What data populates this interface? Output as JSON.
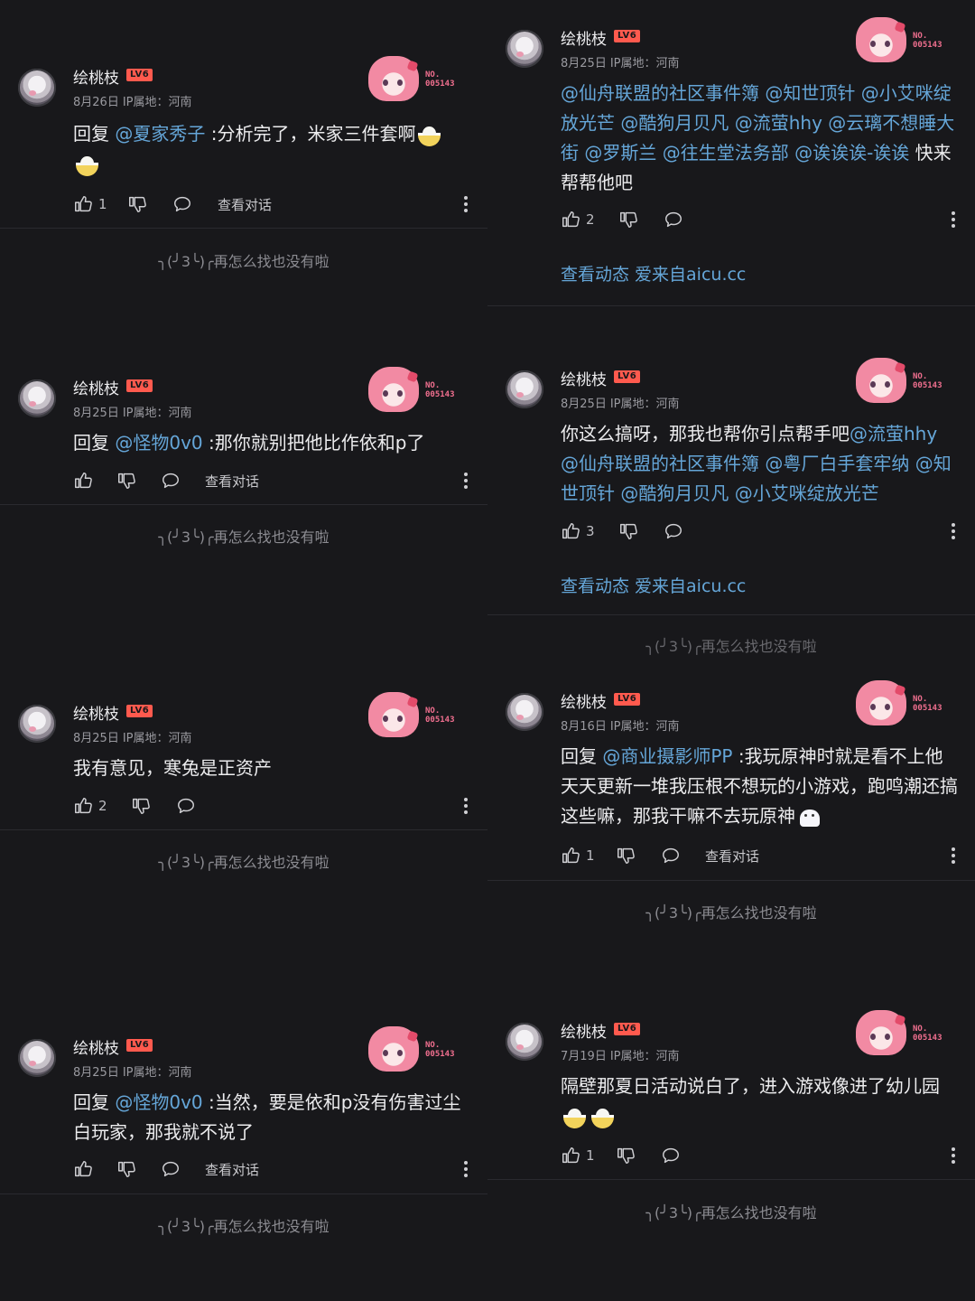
{
  "common": {
    "username": "绘桃枝",
    "level": "LV6",
    "location": "IP属地：河南",
    "badge_no": "NO.",
    "badge_num": "005143",
    "view_dialog": "查看对话",
    "end_note": "╮(╯3╰)╭再怎么找也没有啦",
    "footer_link": "查看动态 爱来自aicu.cc"
  },
  "left": [
    {
      "date": "8月26日",
      "likes": "1",
      "parts": [
        {
          "t": "回复 "
        },
        {
          "t": "@夏家秀子",
          "m": true
        },
        {
          "t": " :分析完了，米家三件套啊"
        },
        {
          "e": "bowl"
        },
        {
          "e": "bowl"
        }
      ]
    },
    {
      "date": "8月25日",
      "likes": "",
      "parts": [
        {
          "t": "回复 "
        },
        {
          "t": "@怪物0v0",
          "m": true
        },
        {
          "t": " :那你就别把他比作依和p了"
        }
      ]
    },
    {
      "date": "8月25日",
      "likes": "2",
      "parts": [
        {
          "t": "我有意见，寒兔是正资产"
        }
      ]
    },
    {
      "date": "8月25日",
      "likes": "",
      "parts": [
        {
          "t": "回复 "
        },
        {
          "t": "@怪物0v0",
          "m": true
        },
        {
          "t": " :当然，要是依和p没有伤害过尘白玩家，那我就不说了"
        }
      ]
    }
  ],
  "right": [
    {
      "date": "8月25日",
      "likes": "2",
      "parts": [
        {
          "t": "@仙舟联盟的社区事件簿 @知世顶针 @小艾咪绽放光芒 @酷狗月贝凡 @流萤hhy @云璃不想睡大街 @罗斯兰 @往生堂法务部 @诶诶诶-诶诶",
          "m": true
        },
        {
          "t": " 快来帮帮他吧"
        }
      ]
    },
    {
      "date": "8月25日",
      "likes": "3",
      "parts": [
        {
          "t": "你这么搞呀，那我也帮你引点帮手吧"
        },
        {
          "t": "@流萤hhy @仙舟联盟的社区事件簿 @粤厂白手套牢纳 @知世顶针 @酷狗月贝凡 @小艾咪绽放光芒",
          "m": true
        }
      ]
    },
    {
      "date": "8月16日",
      "likes": "1",
      "parts": [
        {
          "t": "回复 "
        },
        {
          "t": "@商业摄影师PP",
          "m": true
        },
        {
          "t": " :我玩原神时就是看不上他天天更新一堆我压根不想玩的小游戏，跑鸣潮还搞这些嘛，那我干嘛不去玩原神"
        },
        {
          "e": "ghost"
        }
      ]
    },
    {
      "date": "7月19日",
      "likes": "1",
      "parts": [
        {
          "t": "隔壁那夏日活动说白了，进入游戏像进了幼儿园"
        },
        {
          "e": "bowl"
        },
        {
          "e": "bowl"
        }
      ]
    }
  ]
}
